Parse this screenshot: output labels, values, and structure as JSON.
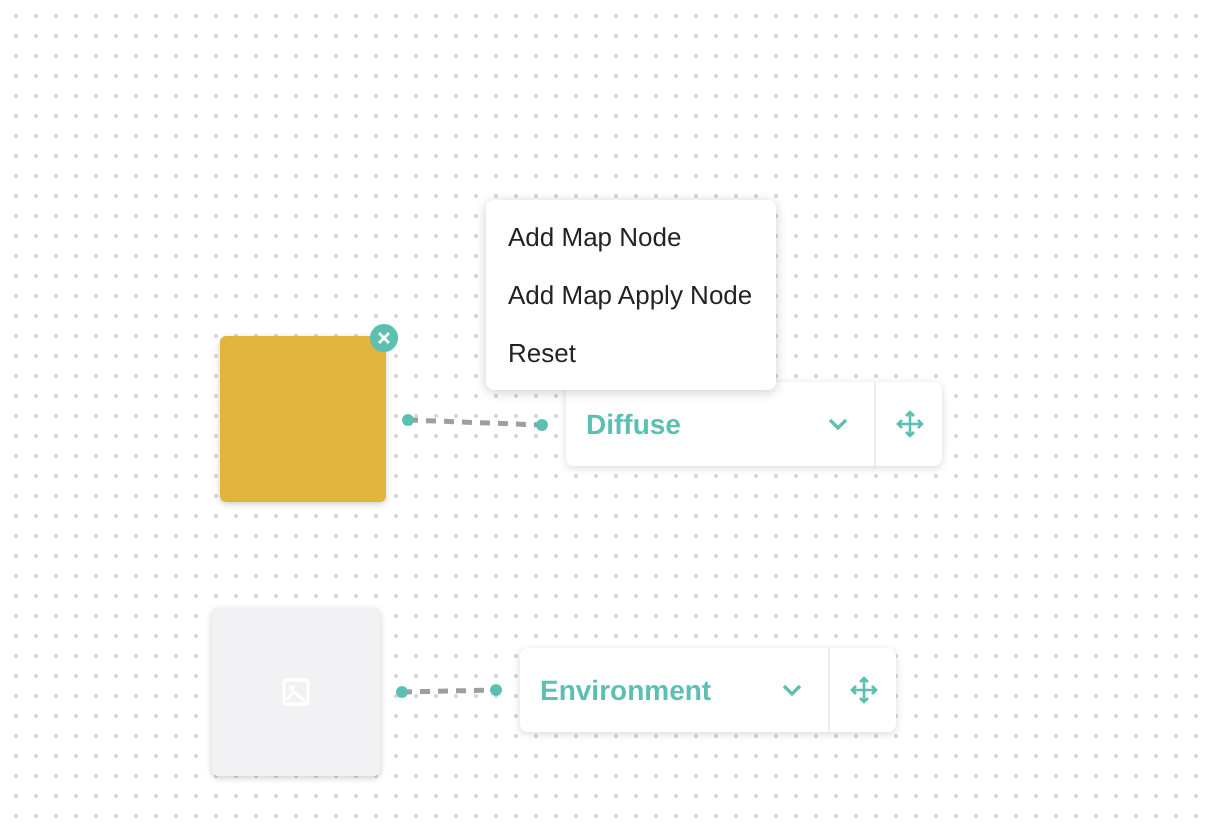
{
  "context_menu": {
    "items": [
      {
        "label": "Add Map Node"
      },
      {
        "label": "Add Map Apply Node"
      },
      {
        "label": "Reset"
      }
    ]
  },
  "nodes": [
    {
      "kind": "color",
      "color": "#e1b43c",
      "removable": true,
      "label": "Diffuse"
    },
    {
      "kind": "image",
      "removable": false,
      "label": "Environment"
    }
  ]
}
